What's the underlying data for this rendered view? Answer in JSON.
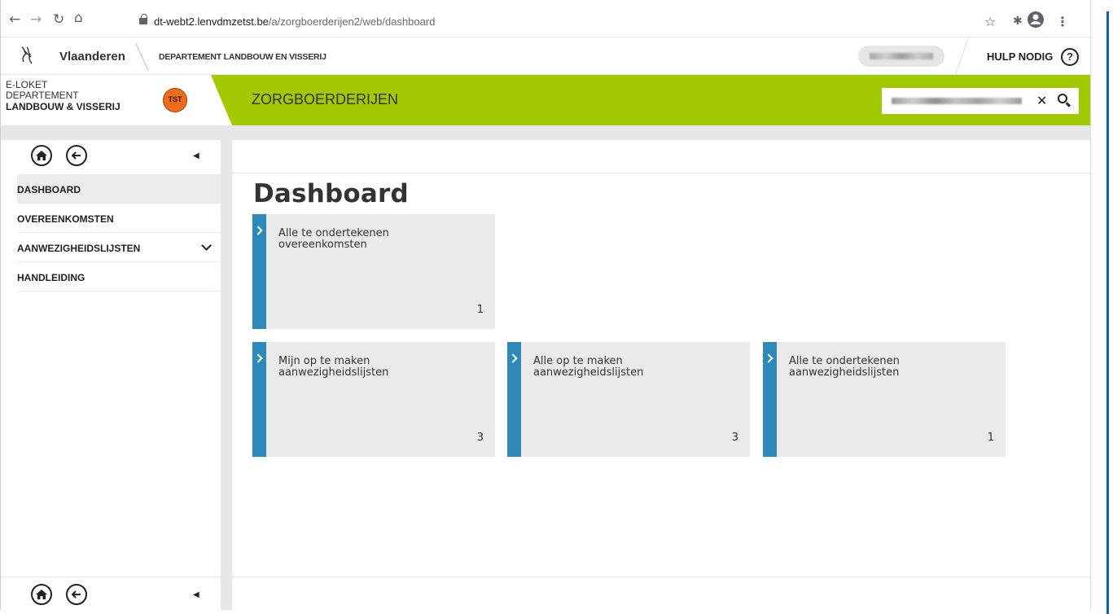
{
  "browser": {
    "url_host": "dt-webt2.lenvdmzetst.be",
    "url_path": "/a/zorgboerderijen2/web/dashboard"
  },
  "site_header": {
    "brand": "Vlaanderen",
    "department": "DEPARTEMENT LANDBOUW EN VISSERIJ",
    "help_label": "HULP NODIG",
    "help_icon": "?"
  },
  "banner": {
    "eloket_line1": "E-LOKET",
    "eloket_line2": "DEPARTEMENT",
    "eloket_line3": "LANDBOUW & VISSERIJ",
    "env_badge": "TST",
    "app_title": "ZORGBOERDERIJEN"
  },
  "sidebar": {
    "items": [
      {
        "label": "DASHBOARD"
      },
      {
        "label": "OVEREENKOMSTEN"
      },
      {
        "label": "AANWEZIGHEIDSLIJSTEN"
      },
      {
        "label": "HANDLEIDING"
      }
    ]
  },
  "main": {
    "title": "Dashboard",
    "tiles": [
      {
        "line1": "Alle te ondertekenen",
        "line2": "overeenkomsten",
        "count": "1"
      },
      {
        "line1": "Mijn op te maken",
        "line2": "aanwezigheidslijsten",
        "count": "3"
      },
      {
        "line1": "Alle op te maken",
        "line2": "aanwezigheidslijsten",
        "count": "3"
      },
      {
        "line1": "Alle te ondertekenen",
        "line2": "aanwezigheidslijsten",
        "count": "1"
      }
    ]
  },
  "colors": {
    "banner_green": "#a2c900",
    "tile_accent": "#2e89b8",
    "badge_orange": "#ee6a1c"
  },
  "icons": [
    "back-arrow-icon",
    "forward-arrow-icon",
    "reload-icon",
    "home-icon",
    "lock-icon",
    "star-icon",
    "extensions-icon",
    "profile-icon",
    "menu-icon",
    "lion-logo-icon",
    "help-icon",
    "clear-icon",
    "search-icon",
    "home-circle-icon",
    "back-circle-icon",
    "collapse-icon",
    "chevron-down-icon",
    "tile-arrow-icon"
  ]
}
